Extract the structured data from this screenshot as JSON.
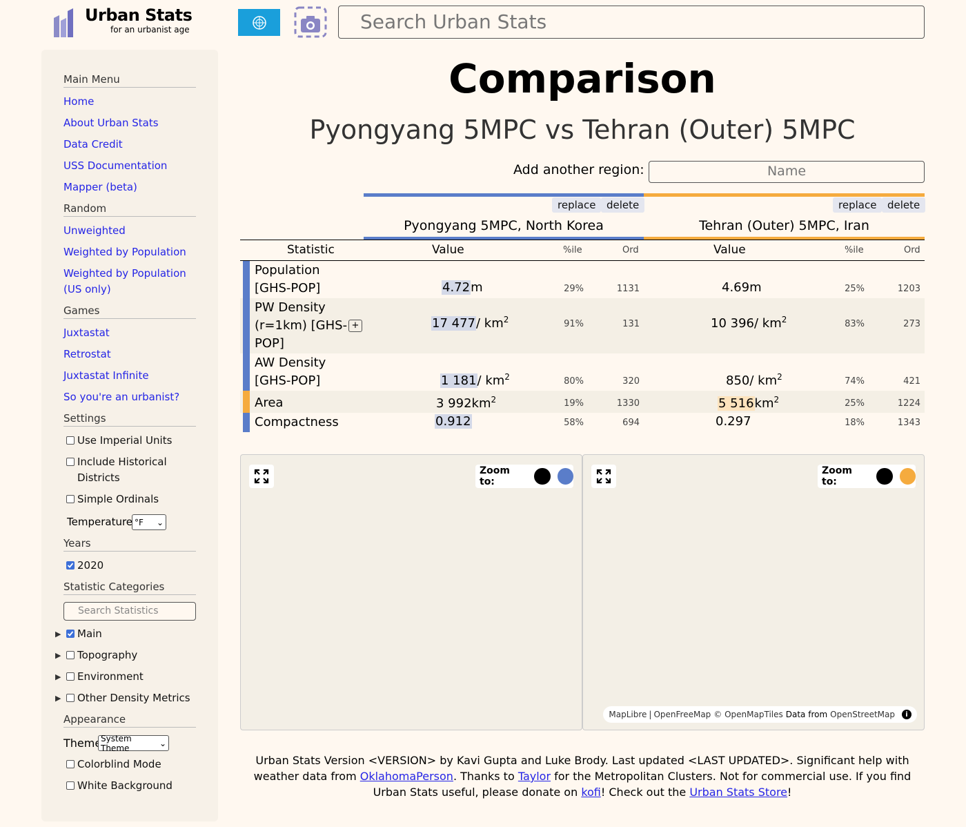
{
  "header": {
    "logo_title": "Urban Stats",
    "logo_tagline": "for an urbanist age",
    "search_placeholder": "Search Urban Stats"
  },
  "sidebar": {
    "main_menu_heading": "Main Menu",
    "main_menu": [
      "Home",
      "About Urban Stats",
      "Data Credit",
      "USS Documentation",
      "Mapper (beta)"
    ],
    "random_heading": "Random",
    "random": [
      "Unweighted",
      "Weighted by Population",
      "Weighted by Population (US only)"
    ],
    "games_heading": "Games",
    "games": [
      "Juxtastat",
      "Retrostat",
      "Juxtastat Infinite",
      "So you're an urbanist?"
    ],
    "settings_heading": "Settings",
    "settings": {
      "imperial": "Use Imperial Units",
      "historical": "Include Historical Districts",
      "simple_ordinals": "Simple Ordinals",
      "temperatures_label": "Temperatures",
      "temperatures_value": "°F"
    },
    "years_heading": "Years",
    "year_2020": "2020",
    "categories_heading": "Statistic Categories",
    "categories_search_placeholder": "Search Statistics",
    "categories": [
      "Main",
      "Topography",
      "Environment",
      "Other Density Metrics"
    ],
    "appearance_heading": "Appearance",
    "theme_label": "Theme",
    "theme_value": "System Theme",
    "colorblind": "Colorblind Mode",
    "white_background": "White Background"
  },
  "main": {
    "title": "Comparison",
    "subtitle": "Pyongyang 5MPC vs Tehran (Outer) 5MPC",
    "add_label": "Add another region:",
    "add_placeholder": "Name",
    "replace_label": "replace",
    "delete_label": "delete",
    "region1": "Pyongyang 5MPC, North Korea",
    "region2": "Tehran (Outer) 5MPC, Iran",
    "col_statistic": "Statistic",
    "col_value": "Value",
    "col_pctile": "%ile",
    "col_ord": "Ord",
    "rows": [
      {
        "name": "Population [GHS-POP]",
        "v1": "4.72",
        "u1": "m",
        "p1": "29%",
        "o1": "1131",
        "v2": "4.69",
        "u2": "m",
        "p2": "25%",
        "o2": "1203"
      },
      {
        "name": "PW Density (r=1km) [GHS-POP]",
        "v1": "17 477",
        "u1": "/ km",
        "p1": "91%",
        "o1": "131",
        "v2": "10 396",
        "u2": "/ km",
        "p2": "83%",
        "o2": "273"
      },
      {
        "name": "AW Density [GHS-POP]",
        "v1": "1 181",
        "u1": "/ km",
        "p1": "80%",
        "o1": "320",
        "v2": "850",
        "u2": "/ km",
        "p2": "74%",
        "o2": "421"
      },
      {
        "name": "Area",
        "v1": "3 992",
        "u1": "km",
        "p1": "19%",
        "o1": "1330",
        "v2": "5 516",
        "u2": "km",
        "p2": "25%",
        "o2": "1224"
      },
      {
        "name": "Compactness",
        "v1": "0.912",
        "u1": "",
        "p1": "58%",
        "o1": "694",
        "v2": "0.297",
        "u2": "",
        "p2": "18%",
        "o2": "1343"
      }
    ],
    "expand_symbol": "+",
    "superscript": "2",
    "zoom_label": "Zoom to:",
    "map_attribution": {
      "maplibre": "MapLibre",
      "openfreemap": "OpenFreeMap",
      "openmaptiles": "© OpenMapTiles",
      "data_from": "Data from",
      "osm": "OpenStreetMap"
    }
  },
  "footer": {
    "t1": "Urban Stats Version <VERSION> by Kavi Gupta and Luke Brody. Last updated <LAST UPDATED>. Significant help with weather data from ",
    "link1": "OklahomaPerson",
    "t2": ". Thanks to ",
    "link2": "Taylor",
    "t3": " for the Metropolitan Clusters. Not for commercial use. If you find Urban Stats useful, please donate on ",
    "link3": "kofi",
    "t4": "! Check out the ",
    "link4": "Urban Stats Store",
    "t5": "!"
  },
  "colors": {
    "region1": "#5a7dc9",
    "region2": "#f5ab3e",
    "link": "#2525e6",
    "background": "#fff8f0"
  }
}
